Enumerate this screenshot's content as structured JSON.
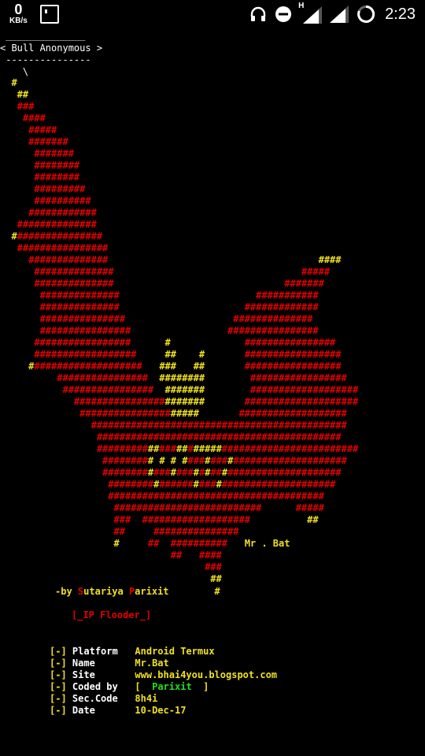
{
  "status_bar": {
    "net_speed": "0",
    "net_unit": "KB/s",
    "signal_type": "H",
    "time": "2:23",
    "icons": [
      "screenshot-icon",
      "headphones-icon",
      "do-not-disturb-icon",
      "signal-icon",
      "battery-icon"
    ]
  },
  "cowsay": {
    "top_line": " ______________",
    "speech": "< Bull Anonymous >",
    "bottom_line": " ---------------",
    "tail": "    \\"
  },
  "credit": {
    "prefix": "-by ",
    "first_initial": "S",
    "first_rest": "utariya ",
    "last_initial": "P",
    "last_rest": "arixit"
  },
  "tool_name": "[_IP Flooder_]",
  "info": [
    {
      "prefix": "[-]",
      "label": "Platform",
      "value": "Android Termux"
    },
    {
      "prefix": "[-]",
      "label": "Name",
      "value": "Mr.Bat"
    },
    {
      "prefix": "[-]",
      "label": "Site",
      "value": "www.bhai4you.blogspot.com"
    },
    {
      "prefix": "[-]",
      "label": "Coded by",
      "value": "[  Parixit  ]"
    },
    {
      "prefix": "[-]",
      "label": "Sec.Code",
      "value": "8h4i"
    },
    {
      "prefix": "[-]",
      "label": "Date",
      "value": "10-Dec-17"
    }
  ],
  "art_signature": "Mr . Bat",
  "colors": {
    "red": "#e00000",
    "yellow": "#f0e020",
    "green": "#20e020",
    "background": "#000000"
  }
}
